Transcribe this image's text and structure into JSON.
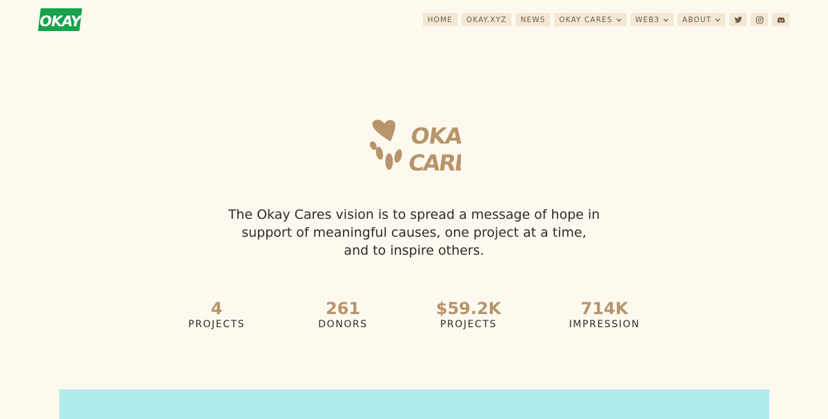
{
  "header": {
    "logo_text": "OKAY",
    "logo_color": "#16a34a",
    "nav": [
      {
        "label": "HOME",
        "dropdown": false
      },
      {
        "label": "OKAY.XYZ",
        "dropdown": false
      },
      {
        "label": "NEWS",
        "dropdown": false
      },
      {
        "label": "OKAY CARES",
        "dropdown": true
      },
      {
        "label": "WEB3",
        "dropdown": true
      },
      {
        "label": "ABOUT",
        "dropdown": true
      }
    ],
    "social": [
      {
        "icon": "twitter-icon"
      },
      {
        "icon": "instagram-icon"
      },
      {
        "icon": "discord-icon"
      }
    ]
  },
  "hero": {
    "brand_line1": "OKAY",
    "brand_line2": "CARES",
    "brand_color": "#b8946b",
    "vision_text": "The Okay Cares vision is to spread a message of hope in support of meaningful causes, one project at a time, and to inspire others."
  },
  "stats": [
    {
      "value": "4",
      "label": "PROJECTS"
    },
    {
      "value": "261",
      "label": "DONORS"
    },
    {
      "value": "$59.2K",
      "label": "PROJECTS"
    },
    {
      "value": "714K",
      "label": "IMPRESSION"
    }
  ],
  "colors": {
    "background": "#fdf9ef",
    "nav_bg": "#f3e8d4",
    "nav_text": "#6f5a44",
    "accent": "#b8946b",
    "teal": "#b0ecec"
  }
}
